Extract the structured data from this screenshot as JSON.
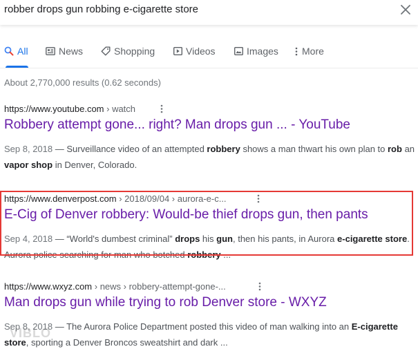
{
  "search": {
    "query": "robber drops gun robbing e-cigarette store"
  },
  "tabs": [
    {
      "label": "All",
      "icon": "search-icon",
      "active": true
    },
    {
      "label": "News",
      "icon": "newspaper-icon"
    },
    {
      "label": "Shopping",
      "icon": "tag-icon"
    },
    {
      "label": "Videos",
      "icon": "play-icon"
    },
    {
      "label": "Images",
      "icon": "image-icon"
    },
    {
      "label": "More",
      "icon": "kebab-icon"
    }
  ],
  "stats": "About 2,770,000 results (0.62 seconds)",
  "results": [
    {
      "domain": "https://www.youtube.com",
      "crumbs": " › watch",
      "title": "Robbery attempt gone... right? Man drops gun ... - YouTube",
      "date": "Sep 8, 2018",
      "snippet_parts": [
        {
          "t": " — Surveillance video of an attempted ",
          "b": false
        },
        {
          "t": "robbery",
          "b": true
        },
        {
          "t": " shows a man thwart his own plan to ",
          "b": false
        },
        {
          "t": "rob",
          "b": true
        },
        {
          "t": " an ",
          "b": false
        },
        {
          "t": "vapor shop",
          "b": true
        },
        {
          "t": " in Denver, Colorado.",
          "b": false
        }
      ]
    },
    {
      "domain": "https://www.denverpost.com",
      "crumbs": " › 2018/09/04 › aurora-e-c...",
      "title": "E-Cig of Denver robbery: Would-be thief drops gun, then pants",
      "date": "Sep 4, 2018",
      "snippet_parts": [
        {
          "t": " — “World's dumbest criminal” ",
          "b": false
        },
        {
          "t": "drops",
          "b": true
        },
        {
          "t": " his ",
          "b": false
        },
        {
          "t": "gun",
          "b": true
        },
        {
          "t": ", then his pants, in Aurora ",
          "b": false
        },
        {
          "t": "e-cigarette store",
          "b": true
        },
        {
          "t": ". Aurora police searching for man who botched ",
          "b": false
        },
        {
          "t": "robbery",
          "b": true
        },
        {
          "t": " ...",
          "b": false
        }
      ]
    },
    {
      "domain": "https://www.wxyz.com",
      "crumbs": " › news › robbery-attempt-gone-...",
      "title": "Man drops gun while trying to rob Denver store - WXYZ",
      "date": "Sep 8, 2018",
      "snippet_parts": [
        {
          "t": " — The Aurora Police Department posted this video of man walking into an ",
          "b": false
        },
        {
          "t": "E-cigarette store",
          "b": true
        },
        {
          "t": ", sporting a Denver Broncos sweatshirt and dark ...",
          "b": false
        }
      ]
    }
  ],
  "watermark": "VIBLO",
  "colors": {
    "accent": "#1a73e8",
    "visited_link": "#681da8",
    "highlight": "#e53935"
  }
}
